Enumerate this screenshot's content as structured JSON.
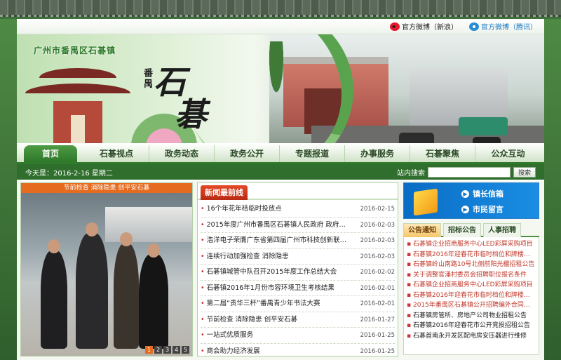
{
  "topbar": {
    "sina_label": "官方微博（新浪）",
    "tencent_label": "官方微博（腾讯）"
  },
  "banner": {
    "region": "广州市番禺区石碁镇",
    "sub": "番禺",
    "big1": "石",
    "big2": "碁"
  },
  "nav": {
    "items": [
      "首页",
      "石碁视点",
      "政务动态",
      "政务公开",
      "专题报道",
      "办事服务",
      "石碁聚焦",
      "公众互动"
    ]
  },
  "datebar": {
    "today": "今天是：2016-2-16 星期二",
    "search_label": "站内搜索",
    "search_button": "搜索",
    "search_value": ""
  },
  "slideshow": {
    "caption": "节前检查 消除隐患 创平安石碁",
    "pages": [
      "1",
      "2",
      "3",
      "4",
      "5"
    ]
  },
  "news": {
    "tab": "新闻最前线",
    "items": [
      {
        "title": "16个年花年桔临时投放点",
        "date": "2016-02-15"
      },
      {
        "title": "2015年度广州市番禺区石碁镇人民政府 政府信息公",
        "date": "2016-02-03"
      },
      {
        "title": "浩洋电子荣膺广东省第四届广州市科技创新联盟南山",
        "date": "2016-02-03"
      },
      {
        "title": "连续行动加强检查 消除隐患",
        "date": "2016-02-03"
      },
      {
        "title": "石碁镇城管中队召开2015年度工作总结大会",
        "date": "2016-02-02"
      },
      {
        "title": "石碁镇2016年1月份市容环境卫生考核结果",
        "date": "2016-02-01"
      },
      {
        "title": "第二届“贵华三杯”番禺青少年书法大赛",
        "date": "2016-02-01"
      },
      {
        "title": "节前检查 消除隐患 创平安石碁",
        "date": "2016-01-27"
      },
      {
        "title": "一站式优质服务",
        "date": "2016-01-25"
      },
      {
        "title": "商会助力经济发展",
        "date": "2016-01-25"
      }
    ]
  },
  "quick": {
    "mayor": "镇长信箱",
    "message": "市民留言"
  },
  "notices": {
    "tabs": [
      "公告通知",
      "招标公告",
      "人事招聘"
    ],
    "items": [
      {
        "text": "石碁镇企业招商服务中心LED彩屏采购项目",
        "color": "red"
      },
      {
        "text": "石碁镇2016年迎春花市临时档位和牌楼招租",
        "color": "red"
      },
      {
        "text": "石碁镇岭山南路10号北侧前阳光棚招租公告",
        "color": "red"
      },
      {
        "text": "关于调整官涌村委员会招聘职位报名条件",
        "color": "red"
      },
      {
        "text": "石碁镇企业招商服务中心LED彩屏采购项目",
        "color": "red"
      },
      {
        "text": "石碁镇2016年迎春花市临时档位和牌楼招租",
        "color": "red"
      },
      {
        "text": "2015年番禺区石碁镇公开招聘编外合同制人员",
        "color": "red"
      },
      {
        "text": "石碁镇房管所、房地产公司物业招租公告",
        "color": "blk"
      },
      {
        "text": "石碁镇2016年迎春花市公开竞投招租公告",
        "color": "blk"
      },
      {
        "text": "石碁首南永开发区配电房安压器进行维修",
        "color": "blk"
      }
    ]
  }
}
